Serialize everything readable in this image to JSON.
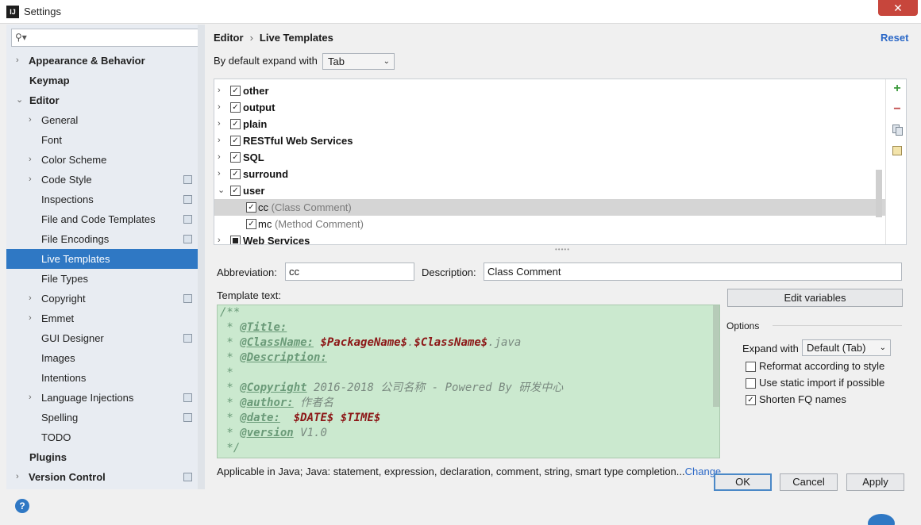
{
  "window": {
    "title": "Settings",
    "close_glyph": "✕"
  },
  "sidebar": {
    "search_placeholder": "",
    "items": [
      {
        "label": "Appearance & Behavior",
        "arrow": "›"
      },
      {
        "label": "Keymap",
        "arrow": ""
      },
      {
        "label": "Editor",
        "arrow": "⌄"
      },
      {
        "label": "General",
        "arrow": "›"
      },
      {
        "label": "Font",
        "arrow": ""
      },
      {
        "label": "Color Scheme",
        "arrow": "›"
      },
      {
        "label": "Code Style",
        "arrow": "›"
      },
      {
        "label": "Inspections",
        "arrow": ""
      },
      {
        "label": "File and Code Templates",
        "arrow": ""
      },
      {
        "label": "File Encodings",
        "arrow": ""
      },
      {
        "label": "Live Templates",
        "arrow": ""
      },
      {
        "label": "File Types",
        "arrow": ""
      },
      {
        "label": "Copyright",
        "arrow": "›"
      },
      {
        "label": "Emmet",
        "arrow": "›"
      },
      {
        "label": "GUI Designer",
        "arrow": ""
      },
      {
        "label": "Images",
        "arrow": ""
      },
      {
        "label": "Intentions",
        "arrow": ""
      },
      {
        "label": "Language Injections",
        "arrow": "›"
      },
      {
        "label": "Spelling",
        "arrow": ""
      },
      {
        "label": "TODO",
        "arrow": ""
      },
      {
        "label": "Plugins",
        "arrow": ""
      },
      {
        "label": "Version Control",
        "arrow": "›"
      }
    ]
  },
  "header": {
    "breadcrumb_editor": "Editor",
    "breadcrumb_sep": "›",
    "breadcrumb_page": "Live Templates",
    "reset": "Reset"
  },
  "expand_default": {
    "label": "By default expand with",
    "value": "Tab"
  },
  "templates": [
    {
      "name": "other",
      "desc": "",
      "arrow": "›",
      "checked": "✓"
    },
    {
      "name": "output",
      "desc": "",
      "arrow": "›",
      "checked": "✓"
    },
    {
      "name": "plain",
      "desc": "",
      "arrow": "›",
      "checked": "✓"
    },
    {
      "name": "RESTful Web Services",
      "desc": "",
      "arrow": "›",
      "checked": "✓"
    },
    {
      "name": "SQL",
      "desc": "",
      "arrow": "›",
      "checked": "✓"
    },
    {
      "name": "surround",
      "desc": "",
      "arrow": "›",
      "checked": "✓"
    },
    {
      "name": "user",
      "desc": "",
      "arrow": "⌄",
      "checked": "✓"
    },
    {
      "name": "cc",
      "desc": "(Class Comment)",
      "arrow": "",
      "checked": "✓"
    },
    {
      "name": "mc",
      "desc": "(Method Comment)",
      "arrow": "",
      "checked": "✓"
    },
    {
      "name": "Web Services",
      "desc": "",
      "arrow": "›",
      "checked": ""
    }
  ],
  "toolbar": {
    "add_glyph": "+",
    "remove_glyph": "−"
  },
  "editor": {
    "abbreviation_label": "Abbreviation:",
    "abbreviation_value": "cc",
    "description_label": "Description:",
    "description_value": "Class Comment",
    "template_text_label": "Template text:",
    "edit_variables": "Edit variables"
  },
  "template_code": {
    "l1": "/**",
    "l2_star": " * ",
    "l2_tag": "@Title:",
    "l3_star": " * ",
    "l3_tag": "@ClassName:",
    "l3_v1": "$PackageName$",
    "l3_dot": ".",
    "l3_v2": "$ClassName$",
    "l3_ext": ".java",
    "l4_star": " * ",
    "l4_tag": "@Description:",
    "l5": " *",
    "l6_star": " * ",
    "l6_tag": "@Copyright",
    "l6_txt": " 2016-2018 公司名称 - Powered By 研发中心",
    "l7_star": " * ",
    "l7_tag": "@author:",
    "l7_txt": " 作者名",
    "l8_star": " * ",
    "l8_tag": "@date:",
    "l8_gap": "  ",
    "l8_v1": "$DATE$",
    "l8_sp": " ",
    "l8_v2": "$TIME$",
    "l9_star": " * ",
    "l9_tag": "@version",
    "l9_txt": " V1.0",
    "l10": " */"
  },
  "options": {
    "title": "Options",
    "expand_label": "Expand with",
    "expand_value": "Default (Tab)",
    "reformat": "Reformat according to style",
    "static_import": "Use static import if possible",
    "shorten_fq": "Shorten FQ names",
    "checkmark": "✓"
  },
  "applicable": {
    "text": "Applicable in Java; Java: statement, expression, declaration, comment, string, smart type completion...",
    "change": "Change"
  },
  "footer": {
    "ok": "OK",
    "cancel": "Cancel",
    "apply": "Apply",
    "help": "?"
  }
}
